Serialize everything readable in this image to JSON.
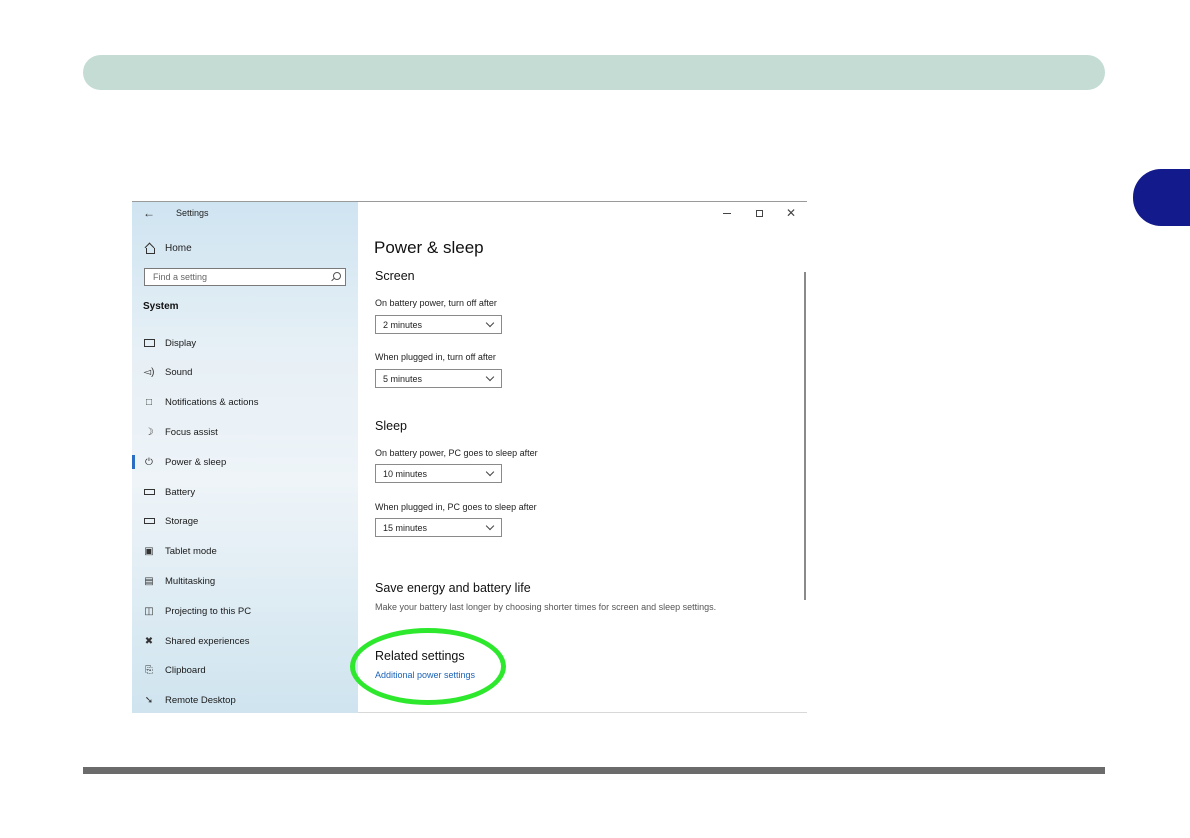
{
  "window": {
    "title": "Settings",
    "home_label": "Home",
    "search_placeholder": "Find a setting",
    "section": "System"
  },
  "sidebar": {
    "items": [
      {
        "label": "Display",
        "icon": "display-icon"
      },
      {
        "label": "Sound",
        "icon": "sound-icon"
      },
      {
        "label": "Notifications & actions",
        "icon": "notifications-icon"
      },
      {
        "label": "Focus assist",
        "icon": "focus-assist-icon"
      },
      {
        "label": "Power & sleep",
        "icon": "power-icon",
        "selected": true
      },
      {
        "label": "Battery",
        "icon": "battery-icon"
      },
      {
        "label": "Storage",
        "icon": "storage-icon"
      },
      {
        "label": "Tablet mode",
        "icon": "tablet-mode-icon"
      },
      {
        "label": "Multitasking",
        "icon": "multitasking-icon"
      },
      {
        "label": "Projecting to this PC",
        "icon": "projecting-icon"
      },
      {
        "label": "Shared experiences",
        "icon": "shared-experiences-icon"
      },
      {
        "label": "Clipboard",
        "icon": "clipboard-icon"
      },
      {
        "label": "Remote Desktop",
        "icon": "remote-desktop-icon"
      }
    ]
  },
  "main": {
    "title": "Power & sleep",
    "screen": {
      "heading": "Screen",
      "battery_label": "On battery power, turn off after",
      "battery_value": "2 minutes",
      "plugged_label": "When plugged in, turn off after",
      "plugged_value": "5 minutes"
    },
    "sleep": {
      "heading": "Sleep",
      "battery_label": "On battery power, PC goes to sleep after",
      "battery_value": "10 minutes",
      "plugged_label": "When plugged in, PC goes to sleep after",
      "plugged_value": "15 minutes"
    },
    "save_energy": {
      "heading": "Save energy and battery life",
      "description": "Make your battery last longer by choosing shorter times for screen and sleep settings."
    },
    "related": {
      "heading": "Related settings",
      "link": "Additional power settings"
    }
  },
  "colors": {
    "header_bar": "#c5dcd5",
    "chapter_tab": "#131a8c",
    "highlight": "#2ee82e",
    "accent": "#2b6cc4",
    "link": "#1b62b8"
  }
}
